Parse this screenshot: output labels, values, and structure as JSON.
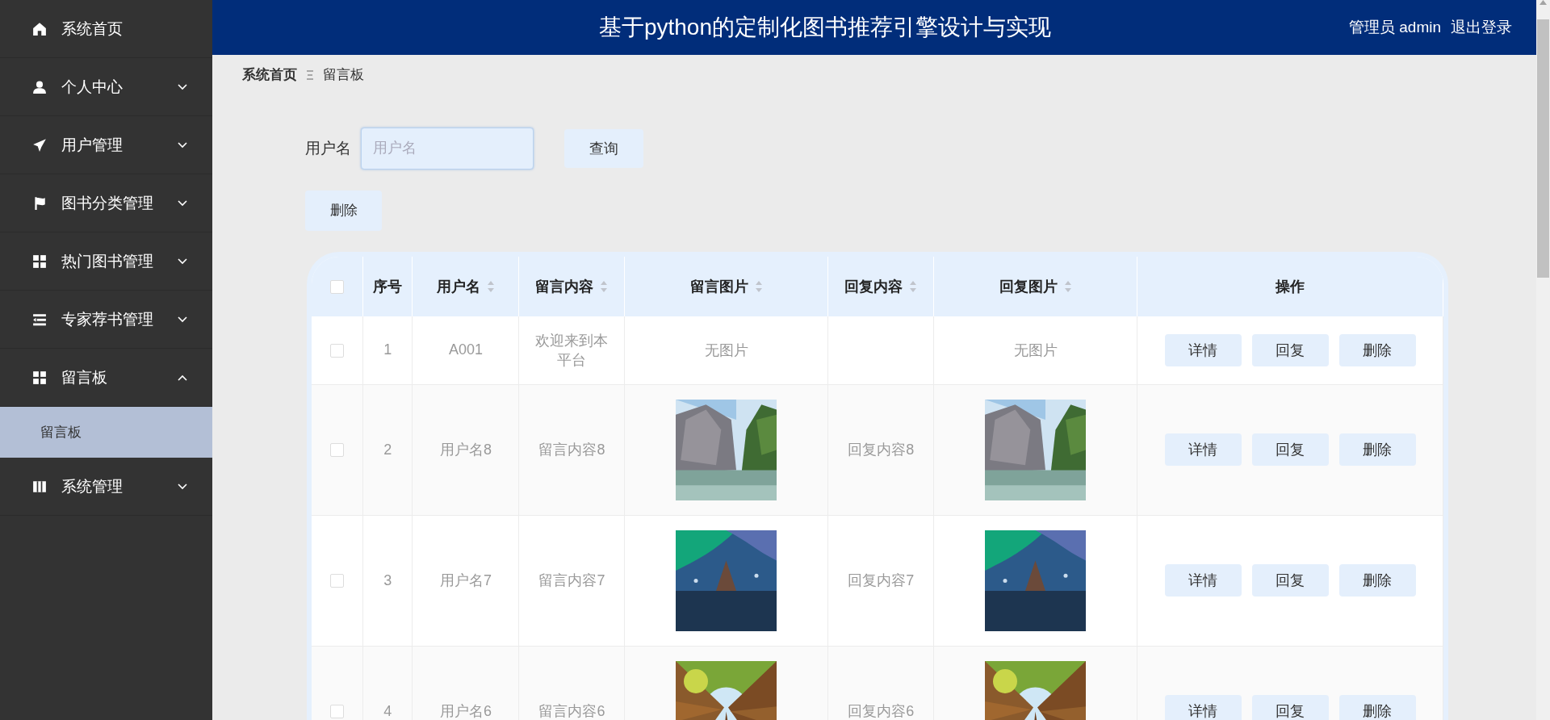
{
  "sidebar": {
    "items": [
      {
        "label": "系统首页",
        "kind": "link"
      },
      {
        "label": "个人中心",
        "kind": "menu",
        "expanded": false
      },
      {
        "label": "用户管理",
        "kind": "menu",
        "expanded": false
      },
      {
        "label": "图书分类管理",
        "kind": "menu",
        "expanded": false
      },
      {
        "label": "热门图书管理",
        "kind": "menu",
        "expanded": false
      },
      {
        "label": "专家荐书管理",
        "kind": "menu",
        "expanded": false
      },
      {
        "label": "留言板",
        "kind": "menu",
        "expanded": true,
        "children": [
          {
            "label": "留言板",
            "selected": true
          }
        ]
      },
      {
        "label": "系统管理",
        "kind": "menu",
        "expanded": false
      }
    ]
  },
  "header": {
    "title": "基于python的定制化图书推荐引擎设计与实现",
    "user": "管理员 admin",
    "logout": "退出登录"
  },
  "breadcrumb": [
    "系统首页",
    "留言板"
  ],
  "search": {
    "label": "用户名",
    "placeholder": "用户名",
    "button": "查询"
  },
  "delete_button": "删除",
  "table": {
    "all_checked": false,
    "columns": [
      {
        "label": "序号",
        "sortable": false
      },
      {
        "label": "用户名",
        "sortable": true
      },
      {
        "label": "留言内容",
        "sortable": true
      },
      {
        "label": "留言图片",
        "sortable": true
      },
      {
        "label": "回复内容",
        "sortable": true
      },
      {
        "label": "回复图片",
        "sortable": true
      },
      {
        "label": "操作",
        "sortable": false
      }
    ],
    "rows": [
      {
        "checked": false,
        "index": "1",
        "username": "A001",
        "content": "欢迎来到本平台",
        "image": {
          "kind": "text",
          "text": "无图片"
        },
        "reply": "",
        "reply_image": {
          "kind": "text",
          "text": "无图片"
        },
        "actions": [
          "详情",
          "回复",
          "删除"
        ]
      },
      {
        "checked": false,
        "index": "2",
        "username": "用户名8",
        "content": "留言内容8",
        "reply": "回复内容8",
        "actions": [
          "详情",
          "回复",
          "删除"
        ]
      },
      {
        "checked": false,
        "index": "3",
        "username": "用户名7",
        "content": "留言内容7",
        "reply": "回复内容7",
        "actions": [
          "详情",
          "回复",
          "删除"
        ]
      },
      {
        "checked": false,
        "index": "4",
        "username": "用户名6",
        "content": "留言内容6",
        "reply": "回复内容6",
        "actions": [
          "详情",
          "回复",
          "删除"
        ]
      }
    ]
  }
}
